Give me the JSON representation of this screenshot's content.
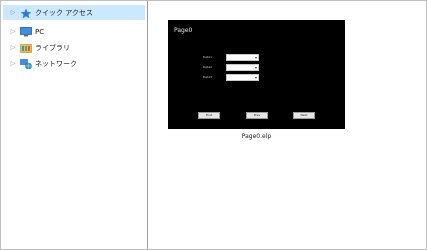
{
  "nav_pane": {
    "items": [
      {
        "label": "クイック アクセス",
        "icon": "star-icon"
      },
      {
        "label": "PC",
        "icon": "pc-icon"
      },
      {
        "label": "ライブラリ",
        "icon": "library-icon"
      },
      {
        "label": "ネットワーク",
        "icon": "network-icon"
      }
    ]
  },
  "preview": {
    "title": "Page0",
    "fields": [
      {
        "label": "Data1"
      },
      {
        "label": "Data2"
      },
      {
        "label": "Data3"
      }
    ],
    "buttons": [
      "First",
      "Prev",
      "Next"
    ],
    "file_name": "Page0.elp"
  },
  "colors": {
    "selection": "#cce8ff",
    "thumb_background": "#000000"
  }
}
